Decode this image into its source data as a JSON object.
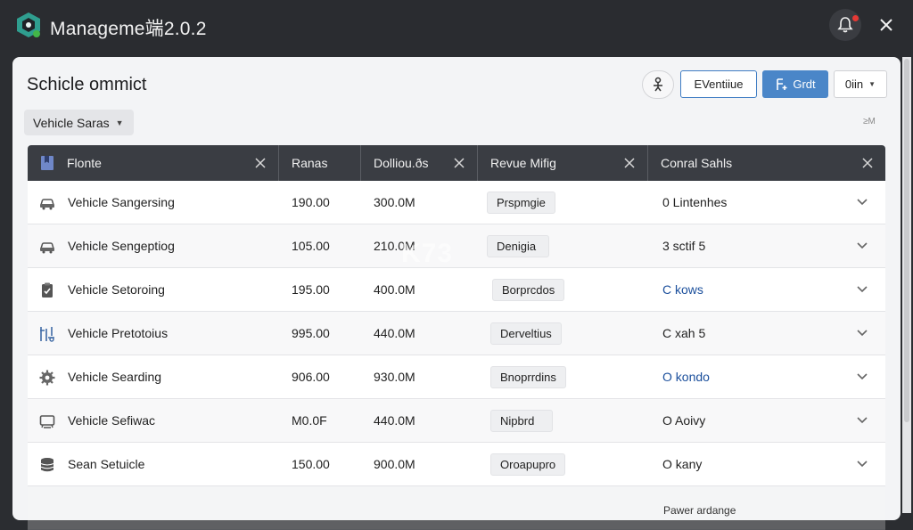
{
  "titlebar": {
    "app_title": "Manageme端2.0.2"
  },
  "page": {
    "title": "Schicle  ommict",
    "size_hint": "≥M"
  },
  "filter": {
    "label": "Vehicle Saras"
  },
  "toolbar": {
    "outline_label": "EVentiiue",
    "primary_label": "Grdt",
    "select_label": "0iin"
  },
  "table": {
    "headers": [
      "Flonte",
      "Ranas",
      "Dolliou.ðs",
      "Revue Mifig",
      "Conral Sahls"
    ],
    "rows": [
      {
        "icon": "car-icon",
        "name": "Vehicle Sangersing",
        "rate": "190.00",
        "dol": "300.0M",
        "pill": "Prspmgie",
        "status": "0 Lintenhes"
      },
      {
        "icon": "car-icon",
        "name": "Vehicle Sengeptiog",
        "rate": "105.00",
        "dol": "210.0M",
        "pill": "Denigia",
        "status": "3 sctif 5"
      },
      {
        "icon": "clipboard-check-icon",
        "name": "Vehicle Setoroing",
        "rate": "195.00",
        "dol": "400.0M",
        "pill": "Borprcdos",
        "status": "C kows"
      },
      {
        "icon": "grid-tool-icon",
        "name": "Vehicle Pretotoius",
        "rate": "995.00",
        "dol": "440.0M",
        "pill": "Derveltius",
        "status": "C xah 5"
      },
      {
        "icon": "gear-icon",
        "name": "Vehicle Searding",
        "rate": "906.00",
        "dol": "930.0M",
        "pill": "Bnoprrdins",
        "status": "O kondo"
      },
      {
        "icon": "monitor-icon",
        "name": "Vehicle Sefiwac",
        "rate": "M0.0F",
        "dol": "440.0M",
        "pill": "Nipbrd",
        "status": "O Aoivy"
      },
      {
        "icon": "database-icon",
        "name": "Sean Setuicle",
        "rate": "150.00",
        "dol": "900.0M",
        "pill": "Oroapupro",
        "status": "O kany"
      }
    ]
  },
  "footer": {
    "note": "Pawer ardange"
  },
  "watermark": "K73",
  "colors": {
    "titlebar": "#2a2c30",
    "header": "#3a3d43",
    "primary": "#4a86c8",
    "alert": "#e53935"
  }
}
